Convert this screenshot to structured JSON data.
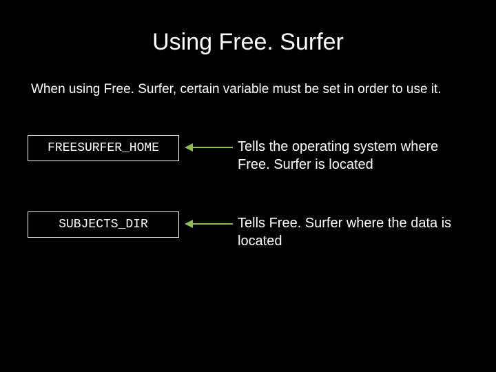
{
  "title": "Using Free. Surfer",
  "intro": "When using Free. Surfer, certain variable must be set in order to use it.",
  "rows": [
    {
      "var": "FREESURFER_HOME",
      "desc": "Tells the operating system where Free. Surfer is located"
    },
    {
      "var": "SUBJECTS_DIR",
      "desc": "Tells Free. Surfer where the data is located"
    }
  ]
}
